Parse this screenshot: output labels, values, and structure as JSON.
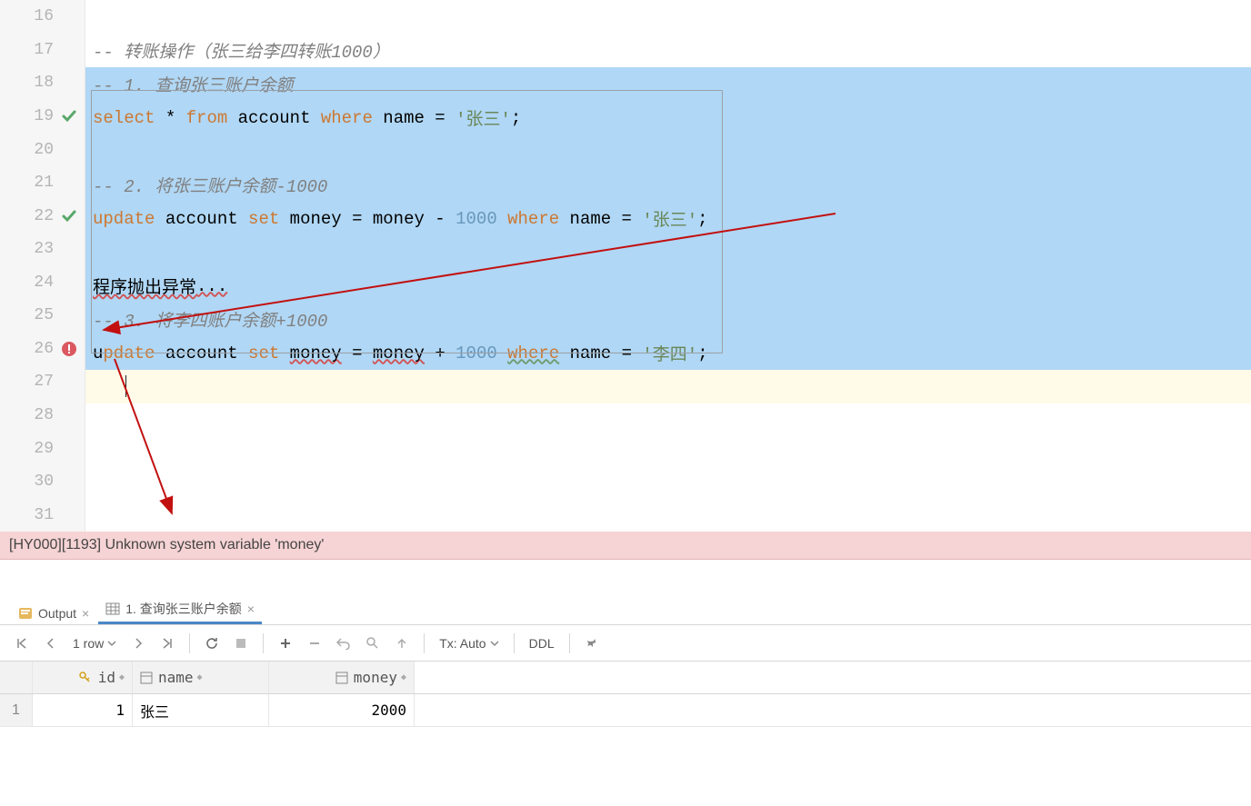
{
  "editor": {
    "lines": [
      {
        "n": 16,
        "icon": null,
        "sel": false,
        "curr": false,
        "tokens": []
      },
      {
        "n": 17,
        "icon": null,
        "sel": false,
        "curr": false,
        "tokens": [
          {
            "t": "-- 转账操作（张三给李四转账1000）",
            "cls": "comment"
          }
        ]
      },
      {
        "n": 18,
        "icon": null,
        "sel": true,
        "curr": false,
        "tokens": [
          {
            "t": "-- 1. 查询张三账户余额",
            "cls": "comment"
          }
        ]
      },
      {
        "n": 19,
        "icon": "check",
        "sel": true,
        "curr": false,
        "tokens": [
          {
            "t": "select",
            "cls": "kw"
          },
          {
            "t": " * "
          },
          {
            "t": "from",
            "cls": "kw"
          },
          {
            "t": " account "
          },
          {
            "t": "where",
            "cls": "kw"
          },
          {
            "t": " name = "
          },
          {
            "t": "'张三'",
            "cls": "str"
          },
          {
            "t": ";"
          }
        ]
      },
      {
        "n": 20,
        "icon": null,
        "sel": true,
        "curr": false,
        "tokens": []
      },
      {
        "n": 21,
        "icon": null,
        "sel": true,
        "curr": false,
        "tokens": [
          {
            "t": "-- 2. 将张三账户余额-1000",
            "cls": "comment"
          }
        ]
      },
      {
        "n": 22,
        "icon": "check",
        "sel": true,
        "curr": false,
        "tokens": [
          {
            "t": "update",
            "cls": "kw"
          },
          {
            "t": " account "
          },
          {
            "t": "set",
            "cls": "kw"
          },
          {
            "t": " money = money - "
          },
          {
            "t": "1000",
            "cls": "num"
          },
          {
            "t": " "
          },
          {
            "t": "where",
            "cls": "kw"
          },
          {
            "t": " name = "
          },
          {
            "t": "'张三'",
            "cls": "str"
          },
          {
            "t": ";"
          }
        ]
      },
      {
        "n": 23,
        "icon": null,
        "sel": true,
        "curr": false,
        "tokens": []
      },
      {
        "n": 24,
        "icon": null,
        "sel": true,
        "curr": false,
        "tokens": [
          {
            "t": "程序抛出异常",
            "cls": "squiggle"
          },
          {
            "t": "...",
            "cls": "squiggle"
          }
        ]
      },
      {
        "n": 25,
        "icon": null,
        "sel": true,
        "curr": false,
        "tokens": [
          {
            "t": "-- 3. 将李四账户余额+1000",
            "cls": "comment"
          }
        ]
      },
      {
        "n": 26,
        "icon": "error",
        "sel": true,
        "curr": false,
        "tokens": [
          {
            "t": "u"
          },
          {
            "t": "pdate",
            "cls": "kw",
            "warn": true
          },
          {
            "t": " account "
          },
          {
            "t": "set",
            "cls": "kw"
          },
          {
            "t": " "
          },
          {
            "t": "money",
            "cls": "squiggle"
          },
          {
            "t": " = "
          },
          {
            "t": "money",
            "cls": "squiggle"
          },
          {
            "t": " + "
          },
          {
            "t": "1000",
            "cls": "num"
          },
          {
            "t": " "
          },
          {
            "t": "where",
            "cls": "kw squiggle-g"
          },
          {
            "t": " name = "
          },
          {
            "t": "'李四'",
            "cls": "str"
          },
          {
            "t": ";"
          }
        ]
      },
      {
        "n": 27,
        "icon": null,
        "sel": false,
        "curr": true,
        "tokens": []
      },
      {
        "n": 28,
        "icon": null,
        "sel": false,
        "curr": false,
        "tokens": []
      },
      {
        "n": 29,
        "icon": null,
        "sel": false,
        "curr": false,
        "tokens": []
      },
      {
        "n": 30,
        "icon": null,
        "sel": false,
        "curr": false,
        "tokens": []
      },
      {
        "n": 31,
        "icon": null,
        "sel": false,
        "curr": false,
        "tokens": []
      }
    ]
  },
  "error_banner": "[HY000][1193] Unknown system variable 'money'",
  "tabs": {
    "output": "Output",
    "result": "1. 查询张三账户余额"
  },
  "toolbar": {
    "rowcount": "1 row",
    "tx": "Tx: Auto",
    "ddl": "DDL"
  },
  "table": {
    "headers": {
      "id": "id",
      "name": "name",
      "money": "money"
    },
    "rows": [
      {
        "rownum": "1",
        "id": "1",
        "name": "张三",
        "money": "2000"
      }
    ]
  }
}
